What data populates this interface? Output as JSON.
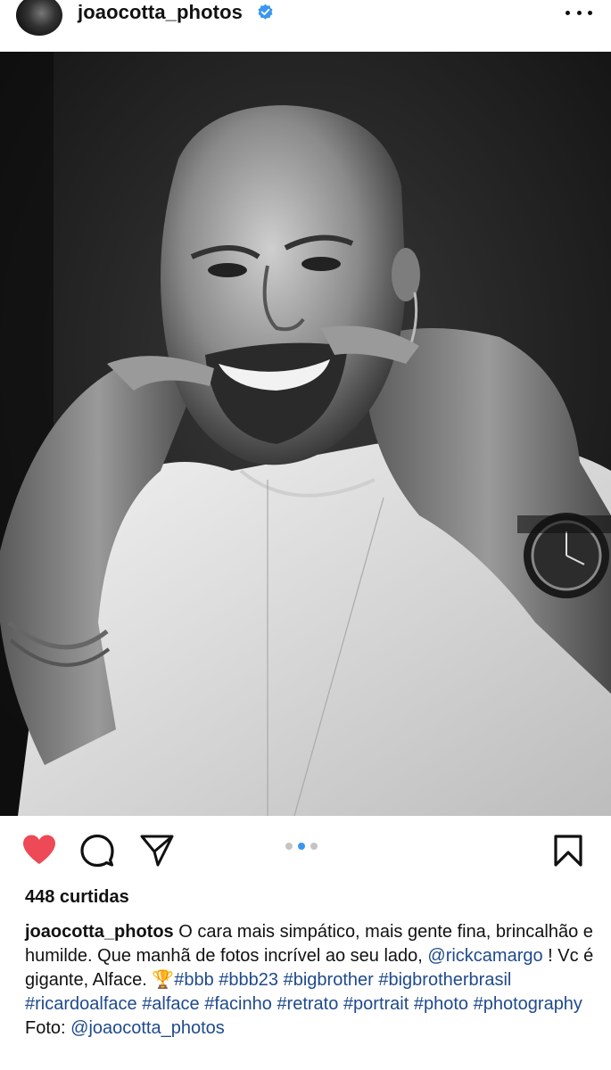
{
  "post": {
    "username": "joaocotta_photos",
    "verified_icon": "verified-badge-icon",
    "more_icon": "more-options-icon",
    "likes": "448 curtidas",
    "carousel": {
      "count": 3,
      "active_index": 1
    },
    "actions": {
      "like_icon": "heart-filled-icon",
      "comment_icon": "comment-icon",
      "share_icon": "paper-plane-icon",
      "save_icon": "bookmark-icon",
      "like_color": "#ed4956"
    },
    "caption": {
      "author": "joaocotta_photos",
      "text_1": " O cara mais simpático, mais gente fina, brincalhão e humilde. Que manhã de fotos incrível ao seu lado, ",
      "mention_1": "@rickcamargo",
      "text_2": " ! Vc é gigante, Alface. ",
      "emoji": "🏆",
      "hashtags": [
        "#bbb",
        "#bbb23",
        "#bigbrother",
        "#bigbrotherbrasil",
        "#ricardoalface",
        "#alface",
        "#facinho",
        "#retrato",
        "#portrait",
        "#photo",
        "#photography"
      ],
      "credit_label": "Foto: ",
      "credit_mention": "@joaocotta_photos"
    },
    "link_color": "#1f4a8c"
  }
}
